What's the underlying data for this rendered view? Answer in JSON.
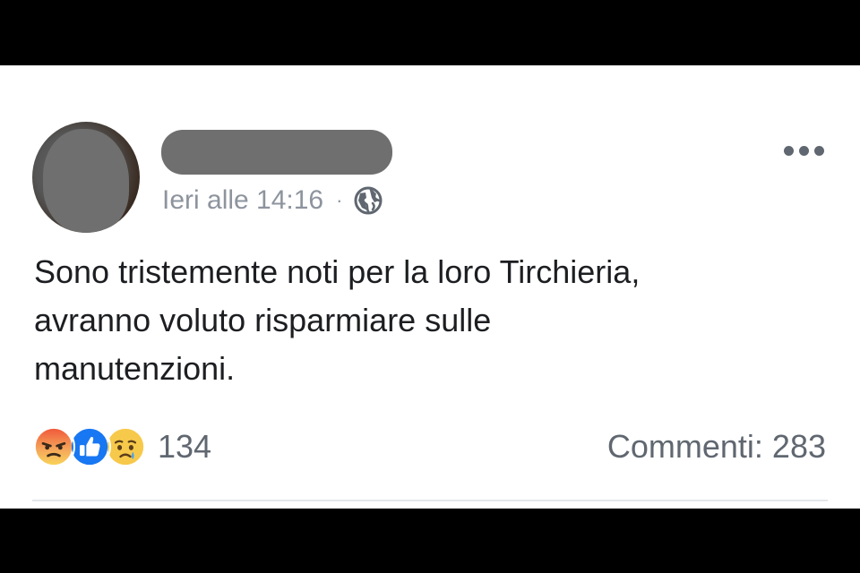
{
  "post": {
    "timestamp": "Ieri alle 14:16",
    "separator": "·",
    "privacy_icon": "globe-icon",
    "more_icon": "ellipsis-icon",
    "text_lines": [
      "Sono tristemente noti per la loro Tirchieria,",
      "avranno voluto risparmiare sulle",
      "manutenzioni."
    ],
    "reactions": {
      "icons": [
        "angry-reaction-icon",
        "like-reaction-icon",
        "sad-reaction-icon"
      ],
      "count": "134"
    },
    "comments_label": "Commenti: 283"
  },
  "colors": {
    "background": "#ffffff",
    "meta_text": "#8d949e",
    "body_text": "#1c1e21",
    "redaction": "#6f6f6f",
    "like_blue": "#1877f2",
    "angry_orange": "#f0683a",
    "sad_yellow": "#f7c94b"
  }
}
